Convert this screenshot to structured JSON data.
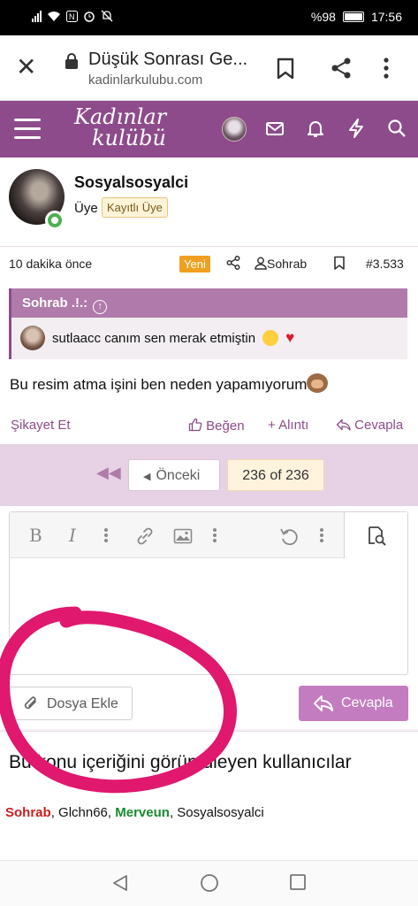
{
  "status_bar": {
    "battery_pct": "%98",
    "time": "17:56",
    "icons": [
      "signal-icon",
      "wifi-icon",
      "nfc-icon",
      "alarm-icon",
      "mute-icon",
      "battery-icon"
    ]
  },
  "browser": {
    "page_title": "Düşük Sonrası Ge...",
    "url": "kadinlarkulubu.com",
    "icons": [
      "close-icon",
      "lock-icon",
      "bookmark-icon",
      "share-icon",
      "more-vert-icon"
    ]
  },
  "site_header": {
    "logo_line1": "Kadınlar",
    "logo_line2": "kulübü",
    "brand_color": "#8e4b8b",
    "icons": [
      "menu-icon",
      "avatar",
      "mail-icon",
      "bell-icon",
      "bolt-icon",
      "search-icon"
    ]
  },
  "post": {
    "username": "Sosyalsosyalci",
    "user_title": "Üye",
    "user_badge": "Kayıtlı Üye",
    "time": "10 dakika önce",
    "new_badge": "Yeni",
    "author_link": "Sohrab",
    "post_number": "#3.533",
    "quote": {
      "author": "Sohrab .!.:",
      "text": "sutlaacc canım sen merak etmiştin"
    },
    "text": "Bu resim atma işini ben neden yapamıyorum",
    "actions": {
      "report": "Şikayet Et",
      "like": "Beğen",
      "quote": "+ Alıntı",
      "reply": "Cevapla"
    }
  },
  "pagination": {
    "prev_label": "Önceki",
    "current": "236 of 236"
  },
  "editor": {
    "toolbar_icons": [
      "bold-icon",
      "italic-icon",
      "more-vert-icon",
      "link-icon",
      "image-icon",
      "more-vert-icon",
      "undo-icon",
      "more-vert-icon",
      "preview-icon"
    ],
    "bold_glyph": "B",
    "italic_glyph": "I",
    "attach_label": "Dosya Ekle",
    "submit_label": "Cevapla"
  },
  "viewers": {
    "title": "Bu konu içeriğini görüntüleyen kullanıcılar",
    "users": [
      {
        "name": "Sohrab",
        "style": "red"
      },
      {
        "name": "Glchn66",
        "style": "normal"
      },
      {
        "name": "Merveun",
        "style": "green"
      },
      {
        "name": "Sosyalsosyalci",
        "style": "normal"
      }
    ]
  },
  "annotation": {
    "color": "#e0186e"
  },
  "nav_bar": {
    "icons": [
      "back-icon",
      "home-icon",
      "recents-icon"
    ]
  }
}
